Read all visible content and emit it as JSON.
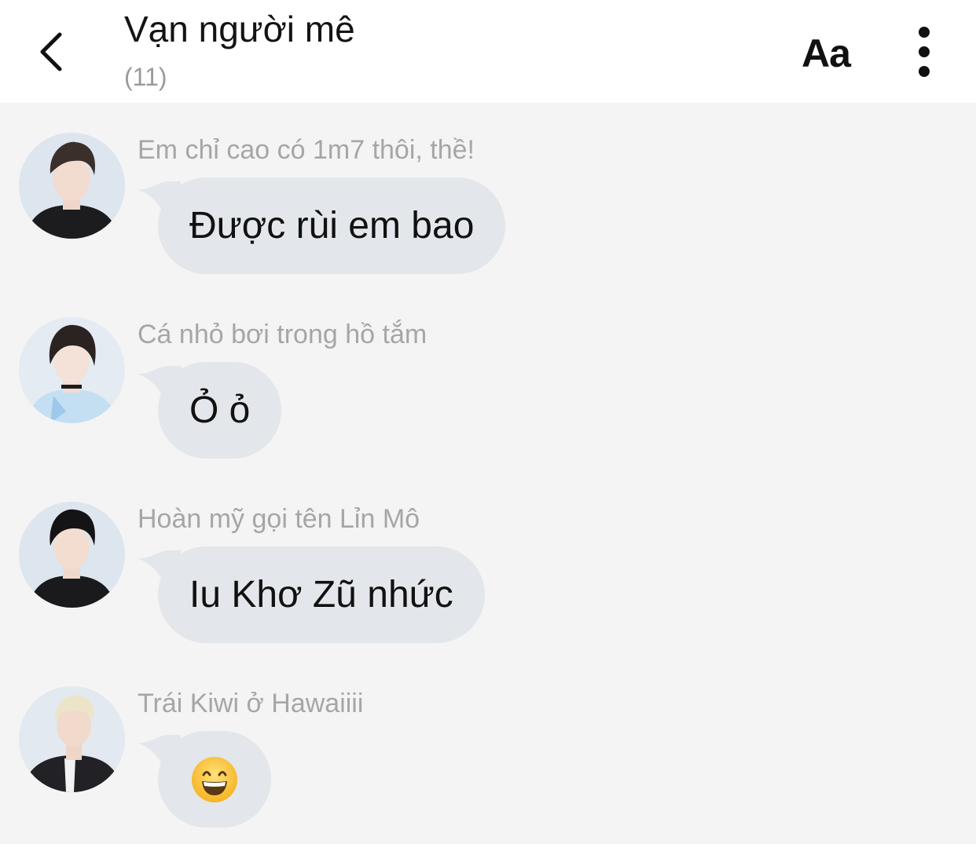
{
  "header": {
    "title": "Vạn người mê",
    "member_count": "(11)",
    "font_button": "Aa"
  },
  "messages": [
    {
      "sender": "Em chỉ cao có 1m7 thôi, thề!",
      "text": "Được rùi em bao"
    },
    {
      "sender": "Cá nhỏ bơi trong hồ tắm",
      "text": "Ỏ ỏ"
    },
    {
      "sender": "Hoàn mỹ gọi tên Lỉn Mô",
      "text": "Iu Khơ Zũ nhức"
    },
    {
      "sender": "Trái Kiwi ở Hawaiiii",
      "text": "",
      "emoji": "grinning-face-emoji"
    }
  ],
  "colors": {
    "header_bg": "#ffffff",
    "chat_bg": "#f4f4f4",
    "bubble_bg": "#e3e6ea",
    "sender_text": "#a6a6a6",
    "count_text": "#9a9a9a"
  }
}
